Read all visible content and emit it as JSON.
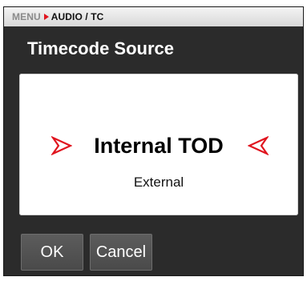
{
  "breadcrumb": {
    "root": "MENU",
    "current": "AUDIO / TC"
  },
  "dialog": {
    "title": "Timecode Source"
  },
  "options": {
    "selected": "Internal TOD",
    "other": "External"
  },
  "buttons": {
    "ok_label": "OK",
    "cancel_label": "Cancel"
  },
  "icons": {
    "breadcrumb_separator": "chevron-right-icon",
    "selector_left": "arrow-right-outline-icon",
    "selector_right": "arrow-left-outline-icon"
  },
  "colors": {
    "accent": "#e0141e",
    "background": "#2b2b2b",
    "panel": "#ffffff",
    "button": "#555555"
  }
}
